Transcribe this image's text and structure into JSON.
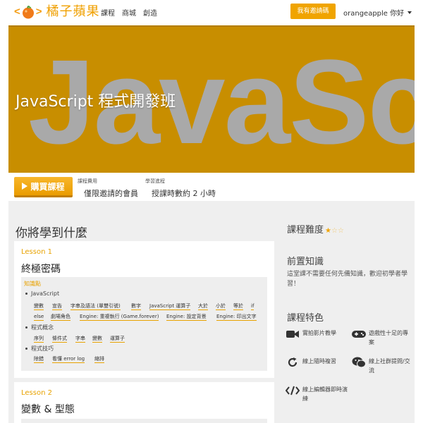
{
  "nav": {
    "logo_text": "橘子蘋果",
    "logo_left_bracket": "<",
    "logo_right_bracket": ">",
    "links": [
      "課程",
      "商城",
      "創造"
    ],
    "invite_button": "我有邀請碼",
    "user_name": "orangeapple 你好"
  },
  "hero": {
    "bg_text": "JavaScri",
    "title": "JavaScript 程式開發班"
  },
  "info": {
    "buy_label": "購買課程",
    "fee_label": "課程費用",
    "fee_value": "僅限邀請的會員",
    "progress_label": "學習進程",
    "progress_value": "授課時數約 2 小時"
  },
  "main": {
    "section_title": "你將學到什麼",
    "lessons": [
      {
        "label": "Lesson 1",
        "title": "終極密碼",
        "kp_label": "知識點",
        "groups": [
          {
            "name": "JavaScript",
            "tags": [
              "變數",
              "宣告",
              "字串及語法 (單雙引號)",
              "數字",
              "JavaScript 運算子",
              "大於",
              "小於",
              "等於",
              "if",
              "else",
              "劇場角色",
              "Engine: 重複執行 (Game.forever)",
              "Engine: 設定背景",
              "Engine: 印出文字"
            ]
          },
          {
            "name": "程式概念",
            "tags": [
              "序列",
              "條件式",
              "字串",
              "變數",
              "運算子"
            ]
          },
          {
            "name": "程式技巧",
            "tags": [
              "除錯",
              "看懂 error log",
              "縮排"
            ]
          }
        ]
      },
      {
        "label": "Lesson 2",
        "title": "變數 & 型態"
      }
    ]
  },
  "sidebar": {
    "difficulty_title": "課程難度",
    "difficulty_rating": 1,
    "difficulty_max": 3,
    "prereq_title": "前置知識",
    "prereq_text": "這堂課不需要任何先備知識，歡迎初學者學習！",
    "features_title": "課程特色",
    "features": [
      {
        "icon": "video-camera-icon",
        "text": "實拍影片教學"
      },
      {
        "icon": "gamepad-icon",
        "text": "遊戲性十足的專案"
      },
      {
        "icon": "refresh-icon",
        "text": "線上隨時複習"
      },
      {
        "icon": "wechat-chat-icon",
        "text": "線上社群提問/交流"
      },
      {
        "icon": "code-icon",
        "text": "線上編輯器即時演練"
      }
    ]
  },
  "colors": {
    "accent": "#f0a400",
    "hero_bg": "#c88e00",
    "main_bg": "#efefef"
  }
}
